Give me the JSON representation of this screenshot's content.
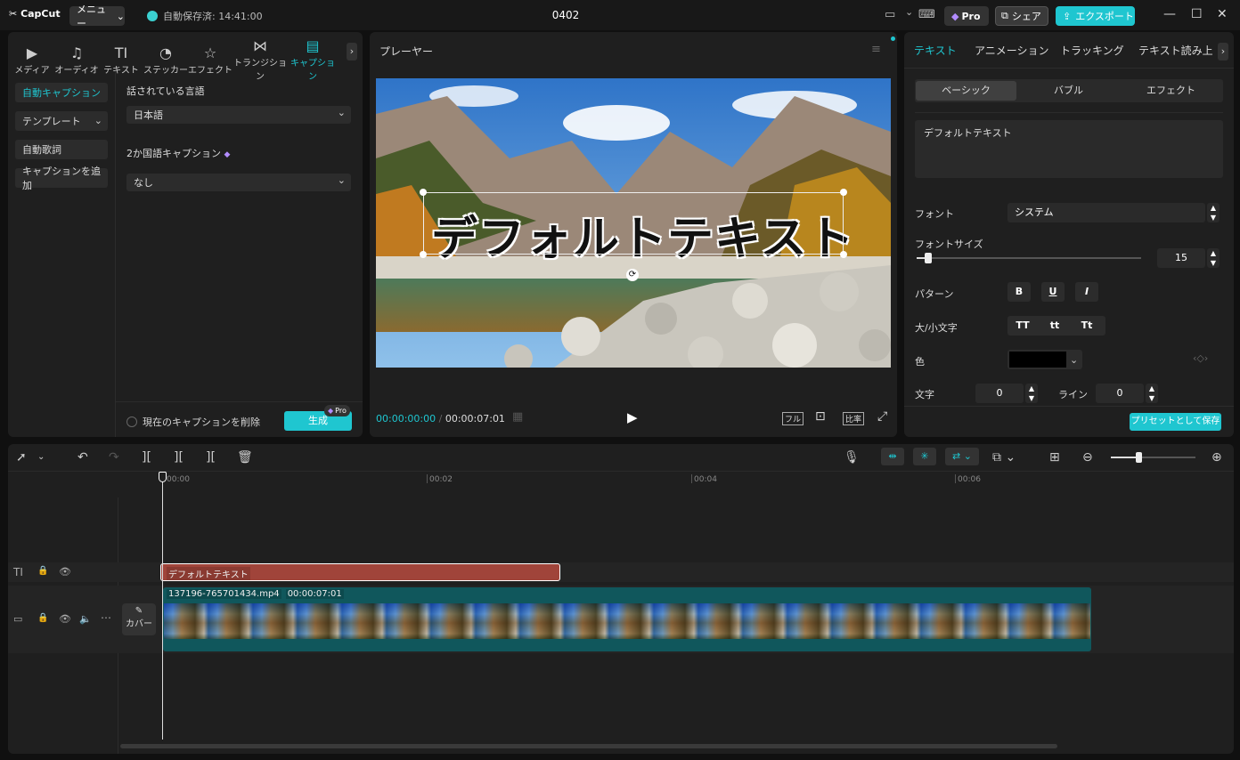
{
  "titlebar": {
    "logo": "CapCut",
    "menu": "メニュー",
    "autosave": "自動保存済: 14:41:00",
    "project": "0402",
    "pro": "Pro",
    "share": "シェア",
    "export": "エクスポート"
  },
  "left": {
    "tabs": [
      {
        "label": "メディア",
        "icon": "media-icon"
      },
      {
        "label": "オーディオ",
        "icon": "audio-icon"
      },
      {
        "label": "テキスト",
        "icon": "text-icon"
      },
      {
        "label": "ステッカー",
        "icon": "sticker-icon"
      },
      {
        "label": "エフェクト",
        "icon": "effect-icon"
      },
      {
        "label": "トランジション",
        "icon": "transition-icon"
      },
      {
        "label": "キャプション",
        "icon": "caption-icon"
      }
    ],
    "side": [
      "自動キャプション",
      "テンプレート",
      "自動歌詞",
      "キャプションを追加"
    ],
    "lang_label": "話されている言語",
    "lang_value": "日本語",
    "bilingual_label": "2か国語キャプション",
    "bilingual_value": "なし",
    "delete_label": "現在のキャプションを削除",
    "generate": "生成",
    "pro_badge": "Pro"
  },
  "player": {
    "title": "プレーヤー",
    "caption": "デフォルトテキスト",
    "time_current": "00:00:00:00",
    "time_total": "00:00:07:01",
    "full": "フル",
    "ratio": "比率"
  },
  "right": {
    "tabs": [
      "テキスト",
      "アニメーション",
      "トラッキング",
      "テキスト読み上"
    ],
    "subtabs": [
      "ベーシック",
      "バブル",
      "エフェクト"
    ],
    "text_value": "デフォルトテキスト",
    "font_label": "フォント",
    "font_value": "システム",
    "size_label": "フォントサイズ",
    "size_value": "15",
    "size_fraction": 0.05,
    "pattern_label": "パターン",
    "pattern": [
      "B",
      "U",
      "I"
    ],
    "case_label": "大/小文字",
    "case": [
      "TT",
      "tt",
      "Tt"
    ],
    "color_label": "色",
    "color_value": "#000000",
    "char_label": "文字",
    "char_value": "0",
    "line_label": "ライン",
    "line_value": "0",
    "save_preset": "プリセットとして保存"
  },
  "timeline": {
    "ruler": [
      "00:00",
      "00:02",
      "00:04",
      "00:06"
    ],
    "text_clip": "デフォルトテキスト",
    "video_name": "137196-765701434.mp4",
    "video_duration": "00:00:07:01",
    "cover": "カバー",
    "zoom_fraction": 0.33
  },
  "colors": {
    "accent": "#1fc6d0",
    "text_clip": "#a0443a",
    "video_clip": "#10575c"
  }
}
